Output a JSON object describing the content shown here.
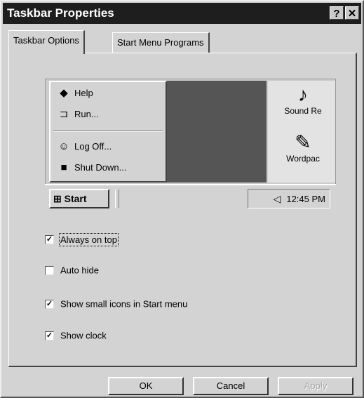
{
  "window": {
    "title": "Taskbar Properties",
    "help_label": "?",
    "close_label": "✕"
  },
  "tabs": [
    {
      "label": "Taskbar Options"
    },
    {
      "label": "Start Menu Programs"
    }
  ],
  "preview": {
    "menu_items": [
      {
        "label": "Help",
        "icon": "help-book-icon"
      },
      {
        "label": "Run...",
        "icon": "run-icon"
      },
      {
        "label": "Log Off...",
        "icon": "log-off-icon"
      },
      {
        "label": "Shut Down...",
        "icon": "shut-down-icon"
      }
    ],
    "desktop_icons": [
      {
        "label": "Sound Re",
        "icon": "sound-recorder-icon"
      },
      {
        "label": "Wordpac",
        "icon": "wordpad-icon"
      }
    ],
    "start_label": "Start",
    "clock": "12:45 PM"
  },
  "options": [
    {
      "label": "Always on top",
      "checked": true
    },
    {
      "label": "Auto hide",
      "checked": false
    },
    {
      "label": "Show small icons in Start menu",
      "checked": true
    },
    {
      "label": "Show clock",
      "checked": true
    }
  ],
  "buttons": {
    "ok": "OK",
    "cancel": "Cancel",
    "apply": "Apply"
  }
}
